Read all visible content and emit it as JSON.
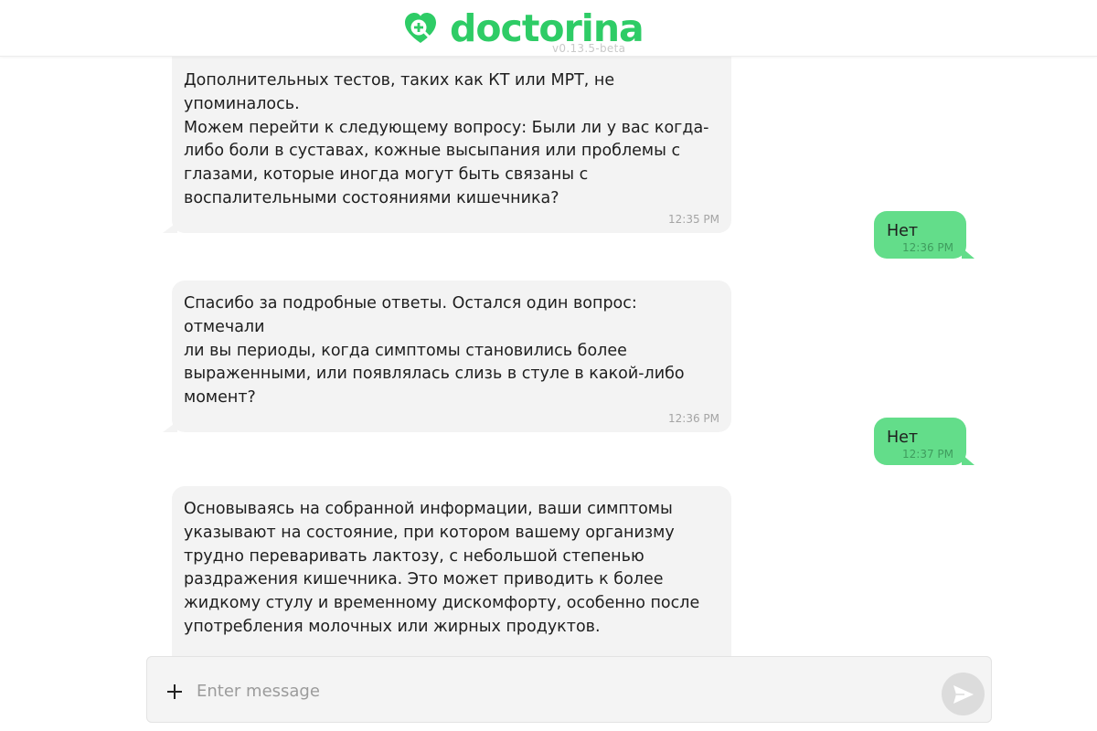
{
  "header": {
    "logo_text": "doctorina",
    "version": "v0.13.5-beta",
    "logo_icon": "heart-plus-icon",
    "brand_color": "#2ecc66"
  },
  "messages": [
    {
      "role": "assistant",
      "text": "Дополнительных тестов, таких как КТ или МРТ, не упоминалось.\nМожем перейти к следующему вопросу: Были ли у вас когда-\nлибо боли в суставах, кожные высыпания или проблемы с\nглазами, которые иногда могут быть связаны с\nвоспалительными состояниями кишечника?",
      "time": "12:35 PM"
    },
    {
      "role": "user",
      "text": "Нет",
      "time": "12:36 PM"
    },
    {
      "role": "assistant",
      "text": "Спасибо за подробные ответы. Остался один вопрос: отмечали\nли вы периоды, когда симптомы становились более\nвыраженными, или появлялась слизь в стуле в какой-либо\nмомент?",
      "time": "12:36 PM"
    },
    {
      "role": "user",
      "text": "Нет",
      "time": "12:37 PM"
    },
    {
      "role": "assistant",
      "text": "Основываясь на собранной информации, ваши симптомы\nуказывают на состояние, при котором вашему организму\nтрудно переваривать лактозу, с небольшой степенью\nраздражения кишечника. Это может приводить к более\nжидкому стулу и временному дискомфорту, особенно после\nупотребления молочных или жирных продуктов.\n\n"
    }
  ],
  "composer": {
    "placeholder": "Enter message",
    "add_icon": "plus-icon",
    "send_icon": "send-icon"
  },
  "colors": {
    "assistant_bubble": "#f3f3f3",
    "user_bubble": "#63dd8a",
    "background": "#ffffff"
  }
}
